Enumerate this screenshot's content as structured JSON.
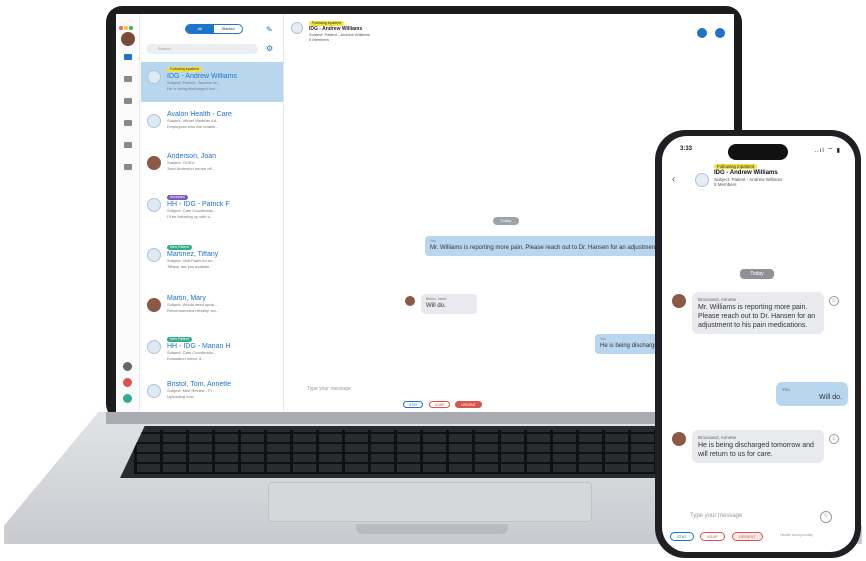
{
  "laptop": {
    "list": {
      "seg_all": "All",
      "seg_starred": "Starred",
      "search_placeholder": "Search",
      "rows": [
        {
          "tag": "Following inpatient",
          "name": "IDG - Andrew Williams",
          "sub1": "Subject: Patient - Andrew W...",
          "sub2": "He is being discharged tom...",
          "time": ""
        },
        {
          "tag": "",
          "name": "Avalon Health - Care",
          "sub1": "Subject: Winter Weather Ad...",
          "sub2": "Employees who are unable...",
          "time": ""
        },
        {
          "tag": "",
          "name": "Anderson, Joan",
          "sub1": "Subject: OOKU",
          "sub2": "Joan Anderson turned off...",
          "time": ""
        },
        {
          "tag": "Accepted",
          "name": "HH - IDG - Patrick F",
          "sub1": "Subject: Care Coordinatio...",
          "sub2": "I'll be following up with o...",
          "time": ""
        },
        {
          "tag": "New Patient",
          "name": "Martinez, Tiffany",
          "sub1": "Subject: Visit Plans for wi...",
          "sub2": "Tiffany, are you availabl...",
          "time": ""
        },
        {
          "tag": "",
          "name": "Martin, Mary",
          "sub1": "Subject: Would need upda...",
          "sub2": "Recommended Healthy, wo...",
          "time": ""
        },
        {
          "tag": "New Patient",
          "name": "HH - IDG - Marian H",
          "sub1": "Subject: Care Coordinatio...",
          "sub2": "Evaluation noted, d...",
          "time": ""
        },
        {
          "tag": "",
          "name": "Bristol, Tom, Annette",
          "sub1": "Subject: Med Review - Pl...",
          "sub2": "Uploading now",
          "time": ""
        }
      ]
    },
    "chat": {
      "tag": "Following inpatient",
      "title": "IDG - Andrew Williams",
      "subject": "Subject: Patient - Andrew Williams",
      "members": "5 Members",
      "date_pill": "Today",
      "msg1_sender": "You",
      "msg1_text": "Mr. Williams is reporting more pain. Please reach out to Dr. Hansen for an adjustment to his pain medications.",
      "msg2_sender": "Bristol, Janet",
      "msg2_text": "Will do.",
      "msg3_sender": "You",
      "msg3_text": "He is being discharged tomorrow and will return",
      "composer_placeholder": "Type your message",
      "quick_replies": [
        "STAT",
        "ASAP",
        "URGENT"
      ]
    }
  },
  "phone": {
    "time": "3:33",
    "signal": "..ıl ⌔ ▮",
    "tag": "Following inpatient",
    "title": "IDG - Andrew Williams",
    "subject": "Subject: Patient - Andrew Williams",
    "members": "5 Members",
    "date_pill": "Today",
    "msg1_sender": "Broussard, Annette",
    "msg1_text": "Mr. Williams is reporting more pain. Please reach out to Dr. Hansen for an adjustment to his pain medications.",
    "msg2_sender": "You",
    "msg2_text": "Will do.",
    "msg3_sender": "Broussard, Annette",
    "msg3_text": "He is being discharged tomorrow and will return to us for care.",
    "composer_placeholder": "Type your message",
    "quick_replies": [
      "STAT",
      "ASAP",
      "URGENT"
    ],
    "handle_label": "Handle Anonymously",
    "colors": {
      "accent": "#1e74c9",
      "bubble_blue": "#b9d6ef",
      "tag_yellow": "#f3e13c",
      "urgent_red": "#d9534f"
    }
  }
}
